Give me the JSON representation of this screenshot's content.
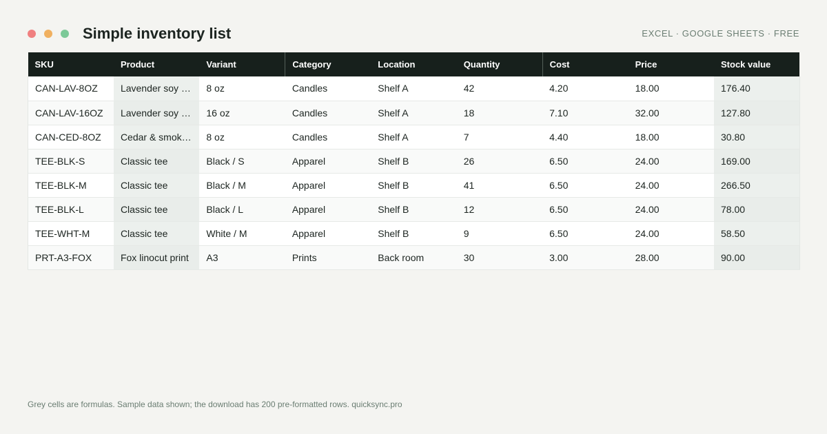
{
  "header": {
    "title": "Simple inventory list",
    "tagline": "EXCEL · GOOGLE SHEETS · FREE",
    "window_dots": [
      "#f08080",
      "#f0b060",
      "#7cc998"
    ]
  },
  "table": {
    "columns": [
      "SKU",
      "Product",
      "Variant",
      "Category",
      "Location",
      "Quantity",
      "Cost",
      "Price",
      "Stock value"
    ],
    "rows": [
      [
        "CAN-LAV-8OZ",
        "Lavender soy candle",
        "8 oz",
        "Candles",
        "Shelf A",
        "42",
        "4.20",
        "18.00",
        "176.40"
      ],
      [
        "CAN-LAV-16OZ",
        "Lavender soy candle",
        "16 oz",
        "Candles",
        "Shelf A",
        "18",
        "7.10",
        "32.00",
        "127.80"
      ],
      [
        "CAN-CED-8OZ",
        "Cedar & smoke candle",
        "8 oz",
        "Candles",
        "Shelf A",
        "7",
        "4.40",
        "18.00",
        "30.80"
      ],
      [
        "TEE-BLK-S",
        "Classic tee",
        "Black / S",
        "Apparel",
        "Shelf B",
        "26",
        "6.50",
        "24.00",
        "169.00"
      ],
      [
        "TEE-BLK-M",
        "Classic tee",
        "Black / M",
        "Apparel",
        "Shelf B",
        "41",
        "6.50",
        "24.00",
        "266.50"
      ],
      [
        "TEE-BLK-L",
        "Classic tee",
        "Black / L",
        "Apparel",
        "Shelf B",
        "12",
        "6.50",
        "24.00",
        "78.00"
      ],
      [
        "TEE-WHT-M",
        "Classic tee",
        "White / M",
        "Apparel",
        "Shelf B",
        "9",
        "6.50",
        "24.00",
        "58.50"
      ],
      [
        "PRT-A3-FOX",
        "Fox linocut print",
        "A3",
        "Prints",
        "Back room",
        "30",
        "3.00",
        "28.00",
        "90.00"
      ]
    ]
  },
  "footnote": "Grey cells are formulas. Sample data shown; the download has 200 pre-formatted rows. quicksync.pro",
  "colors": {
    "header_bg": "#17201c",
    "formula_cell": "#ecf0ed",
    "page_bg": "#f4f4f1"
  }
}
